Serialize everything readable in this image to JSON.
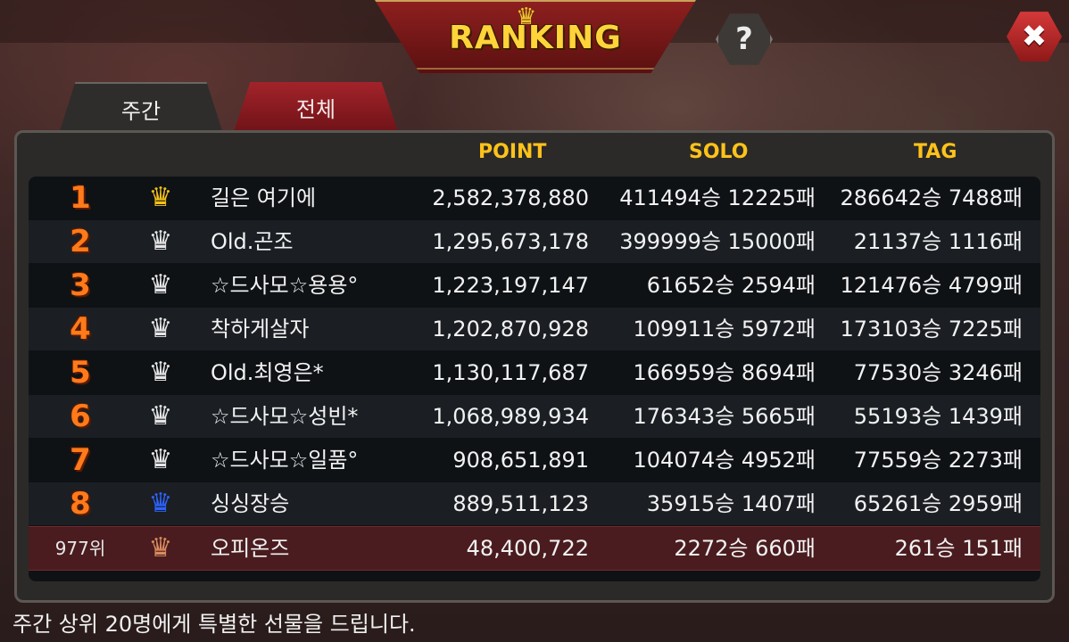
{
  "header": {
    "title": "RANKING",
    "help_label": "?",
    "close_label": "✖"
  },
  "tabs": [
    {
      "label": "주간",
      "active": true
    },
    {
      "label": "전체",
      "active": false
    }
  ],
  "columns": {
    "point": "POINT",
    "solo": "SOLO",
    "tag": "TAG"
  },
  "rows": [
    {
      "rank": "1",
      "crown": "gold",
      "name": "길은 여기에",
      "point": "2,582,378,880",
      "solo": "411494승 12225패",
      "tag": "286642승 7488패"
    },
    {
      "rank": "2",
      "crown": "silver",
      "name": "Old.곤조",
      "point": "1,295,673,178",
      "solo": "399999승 15000패",
      "tag": "21137승 1116패"
    },
    {
      "rank": "3",
      "crown": "silver",
      "name": "☆드사모☆용용°",
      "point": "1,223,197,147",
      "solo": "61652승 2594패",
      "tag": "121476승 4799패"
    },
    {
      "rank": "4",
      "crown": "silver",
      "name": "착하게살자",
      "point": "1,202,870,928",
      "solo": "109911승 5972패",
      "tag": "173103승 7225패"
    },
    {
      "rank": "5",
      "crown": "silver",
      "name": "Old.최영은*",
      "point": "1,130,117,687",
      "solo": "166959승 8694패",
      "tag": "77530승 3246패"
    },
    {
      "rank": "6",
      "crown": "silver",
      "name": "☆드사모☆성빈*",
      "point": "1,068,989,934",
      "solo": "176343승 5665패",
      "tag": "55193승 1439패"
    },
    {
      "rank": "7",
      "crown": "silver",
      "name": "☆드사모☆일품°",
      "point": "908,651,891",
      "solo": "104074승 4952패",
      "tag": "77559승 2273패"
    },
    {
      "rank": "8",
      "crown": "blue",
      "name": "싱싱장승",
      "point": "889,511,123",
      "solo": "35915승 1407패",
      "tag": "65261승 2959패"
    }
  ],
  "my_row": {
    "rank": "977위",
    "crown": "bronze",
    "name": "오피온즈",
    "point": "48,400,722",
    "solo": "2272승 660패",
    "tag": "261승 151패"
  },
  "footer_text": "주간 상위 20명에게 특별한 선물을 드립니다.",
  "crown_colors": {
    "gold": "#f2c019",
    "silver": "#e6e6e6",
    "blue": "#2d63ff",
    "bronze": "#d98b5f"
  },
  "crown_icon": "crown-icon"
}
